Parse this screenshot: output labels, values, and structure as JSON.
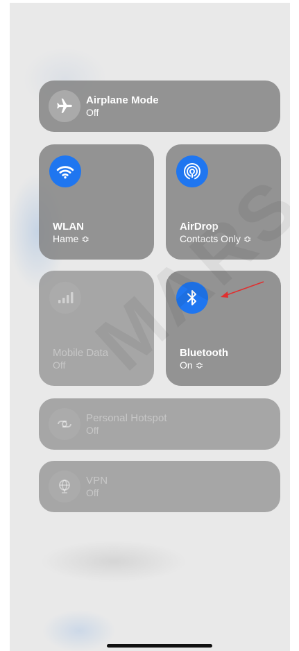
{
  "airplane": {
    "title": "Airplane Mode",
    "status": "Off"
  },
  "wlan": {
    "title": "WLAN",
    "status": "Hame ≎"
  },
  "airdrop": {
    "title": "AirDrop",
    "status": "Contacts Only ≎"
  },
  "mobile_data": {
    "title": "Mobile Data",
    "status": "Off"
  },
  "bluetooth": {
    "title": "Bluetooth",
    "status": "On ≎"
  },
  "hotspot": {
    "title": "Personal Hotspot",
    "status": "Off"
  },
  "vpn": {
    "title": "VPN",
    "status": "Off"
  },
  "watermark": "MARS TF",
  "colors": {
    "accent": "#1f76f0",
    "arrow": "#e03030"
  }
}
